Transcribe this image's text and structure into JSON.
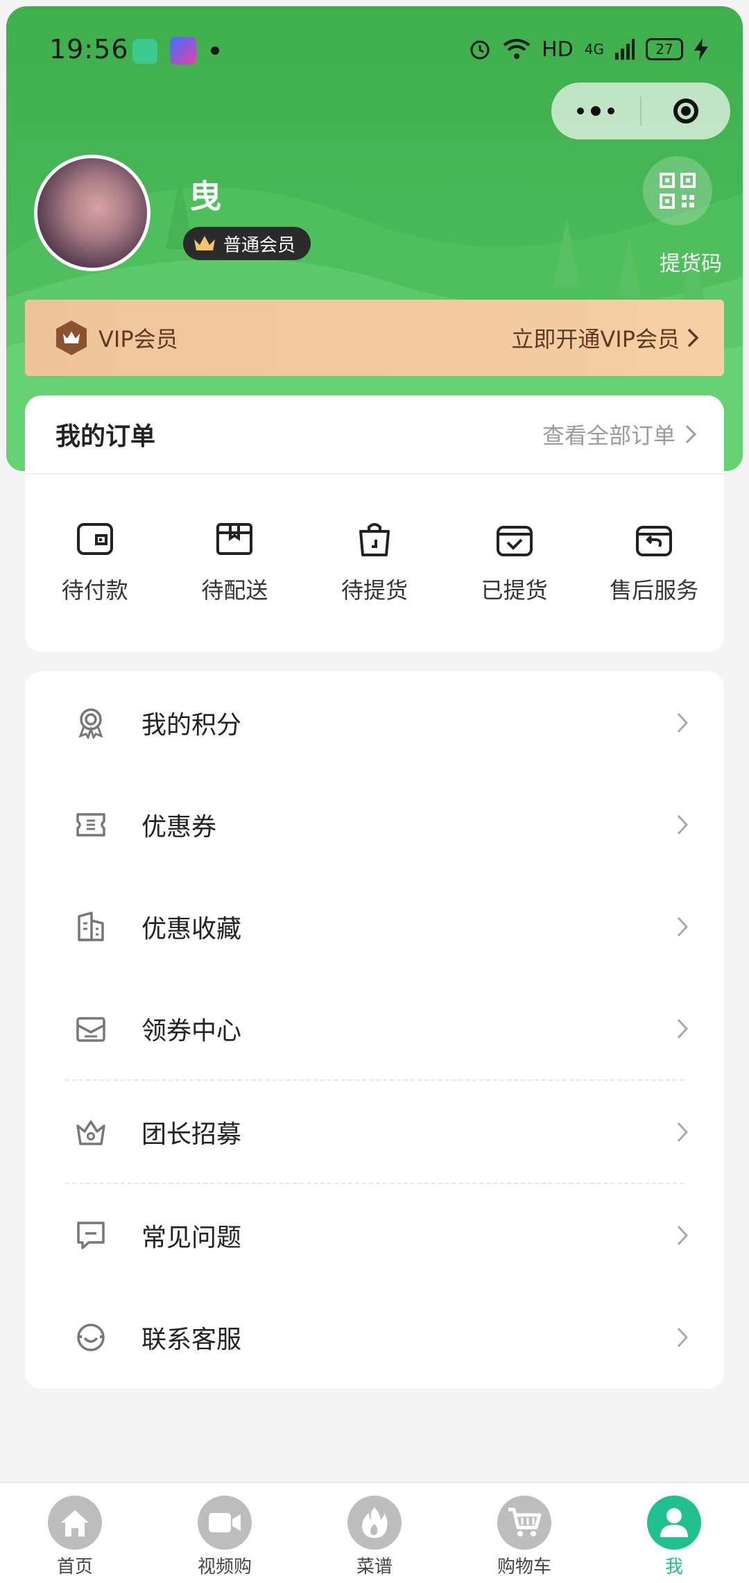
{
  "status_bar": {
    "time": "19:56",
    "network": "HD",
    "signal": "4G",
    "battery": "27"
  },
  "profile": {
    "username": "曳",
    "member_level": "普通会员",
    "pickup_code_label": "提货码"
  },
  "vip": {
    "title": "VIP会员",
    "action": "立即开通VIP会员"
  },
  "orders": {
    "title": "我的订单",
    "view_all": "查看全部订单",
    "items": [
      {
        "label": "待付款",
        "icon": "wallet-icon"
      },
      {
        "label": "待配送",
        "icon": "box-icon"
      },
      {
        "label": "待提货",
        "icon": "bag-icon"
      },
      {
        "label": "已提货",
        "icon": "checked-bag-icon"
      },
      {
        "label": "售后服务",
        "icon": "return-bag-icon"
      }
    ]
  },
  "menu": [
    {
      "label": "我的积分",
      "icon": "medal-icon"
    },
    {
      "label": "优惠券",
      "icon": "coupon-icon"
    },
    {
      "label": "优惠收藏",
      "icon": "favorite-icon"
    },
    {
      "label": "领券中心",
      "icon": "coupon-center-icon"
    },
    {
      "label": "团长招募",
      "icon": "crown-icon"
    },
    {
      "label": "常见问题",
      "icon": "message-icon"
    },
    {
      "label": "联系客服",
      "icon": "headset-icon"
    }
  ],
  "tabbar": [
    {
      "label": "首页",
      "icon": "home-icon",
      "active": false
    },
    {
      "label": "视频购",
      "icon": "video-icon",
      "active": false
    },
    {
      "label": "菜谱",
      "icon": "flame-icon",
      "active": false
    },
    {
      "label": "购物车",
      "icon": "cart-icon",
      "active": false
    },
    {
      "label": "我",
      "icon": "user-icon",
      "active": true
    }
  ],
  "colors": {
    "brand_green": "#47b757",
    "accent_teal": "#1fbf8e",
    "vip_gold": "#f3caa0"
  }
}
